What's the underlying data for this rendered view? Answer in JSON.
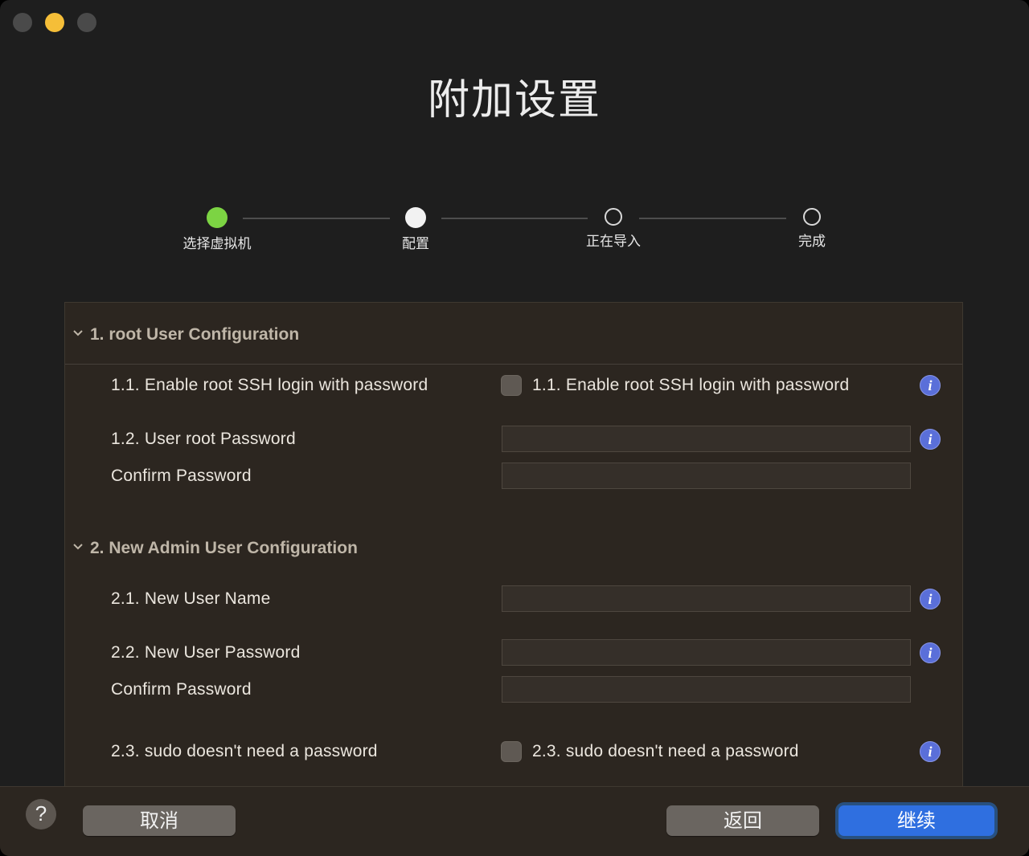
{
  "window": {
    "title": "附加设置"
  },
  "steps": [
    {
      "label": "选择虚拟机",
      "state": "done"
    },
    {
      "label": "配置",
      "state": "current"
    },
    {
      "label": "正在导入",
      "state": "pending"
    },
    {
      "label": "完成",
      "state": "pending"
    }
  ],
  "sections": {
    "root": {
      "title": "1. root User Configuration",
      "ssh_label": "1.1. Enable root SSH login with password",
      "ssh_checkbox_label": "1.1. Enable root SSH login with password",
      "ssh_checked": false,
      "password_label": "1.2. User root Password",
      "password_value": "",
      "confirm_label": "Confirm Password",
      "confirm_value": ""
    },
    "admin": {
      "title": "2. New Admin User Configuration",
      "username_label": "2.1. New User Name",
      "username_value": "",
      "password_label": "2.2. New User Password",
      "password_value": "",
      "confirm_label": "Confirm Password",
      "confirm_value": "",
      "sudo_label": "2.3. sudo doesn't need a password",
      "sudo_checkbox_label": "2.3. sudo doesn't need a password",
      "sudo_checked": false
    }
  },
  "footer": {
    "help": "?",
    "cancel": "取消",
    "back": "返回",
    "continue": "继续"
  },
  "icons": {
    "info": "i",
    "chevron": "chevron-down-icon"
  },
  "colors": {
    "step_done": "#7cd443",
    "primary_button": "#2f6fe0",
    "info_icon": "#5a6fd9"
  }
}
